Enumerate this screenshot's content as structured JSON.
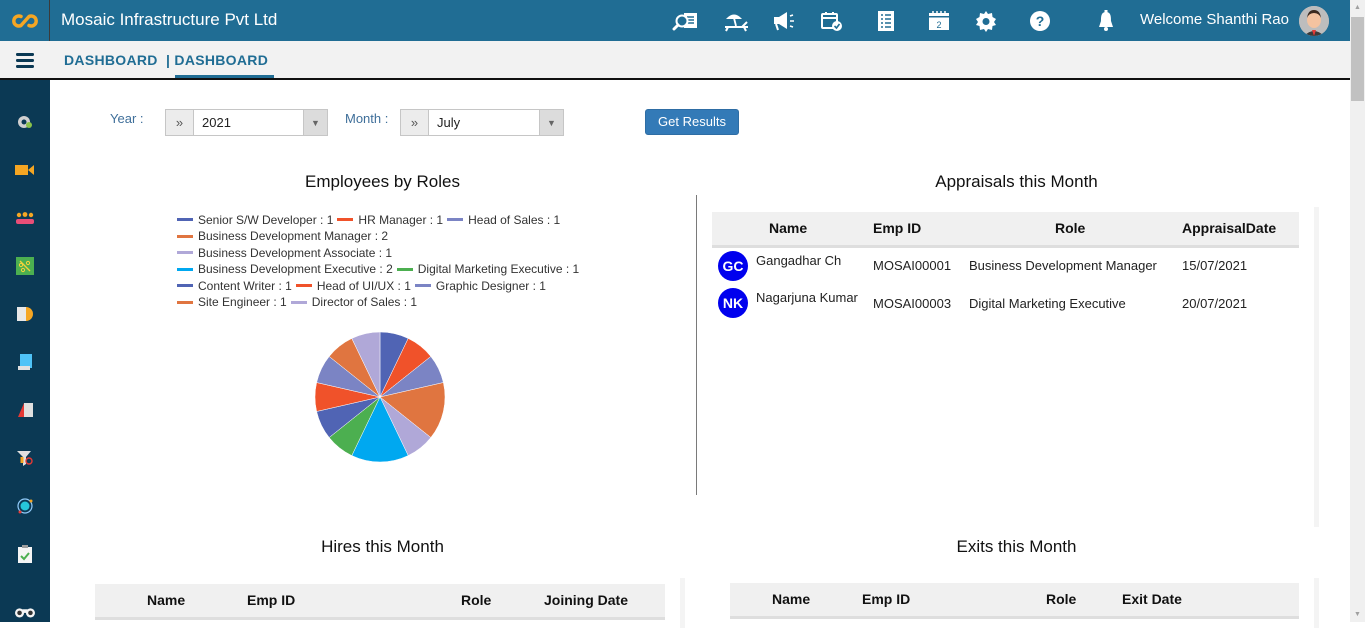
{
  "header": {
    "app_title": "Mosaic Infrastructure Pvt Ltd",
    "logo_icon": "cc-infinity-logo",
    "toolbar_icons": [
      "search-document-icon",
      "beach-holiday-icon",
      "announcement-megaphone-icon",
      "calendar-check-icon",
      "checklist-icon",
      "calendar-date-icon",
      "settings-gear-icon",
      "help-question-icon"
    ],
    "notification_icon": "bell-icon",
    "welcome_text": "Welcome Shanthi Rao",
    "accent_color": "#206d94"
  },
  "breadcrumb": {
    "items": [
      "DASHBOARD",
      "| DASHBOARD"
    ],
    "active_index": 1
  },
  "sidebar": {
    "icons": [
      "settings-user-icon",
      "video-camera-icon",
      "team-icon",
      "network-icon",
      "document-stats-icon",
      "notes-icon",
      "report-book-icon",
      "filter-search-icon",
      "orbit-icon",
      "clipboard-check-icon",
      "binoculars-icon"
    ]
  },
  "filters": {
    "year_label": "Year :",
    "year_value": "2021",
    "month_label": "Month :",
    "month_value": "July",
    "prefix_glyph": "»",
    "get_results_label": "Get Results"
  },
  "employees_by_roles": {
    "title": "Employees by Roles"
  },
  "chart_data": {
    "type": "pie",
    "title": "Employees by Roles",
    "legend_position": "top",
    "slices": [
      {
        "label": "Senior S/W Developer",
        "value": 1,
        "color": "#5064b4"
      },
      {
        "label": "HR Manager",
        "value": 1,
        "color": "#f0522a"
      },
      {
        "label": "Head of Sales",
        "value": 1,
        "color": "#7b84c4"
      },
      {
        "label": "Business Development Manager",
        "value": 2,
        "color": "#e07540"
      },
      {
        "label": "Business Development Associate",
        "value": 1,
        "color": "#b0a8d8"
      },
      {
        "label": "Business Development Executive",
        "value": 2,
        "color": "#00a8f0"
      },
      {
        "label": "Digital Marketing Executive",
        "value": 1,
        "color": "#4caf50"
      },
      {
        "label": "Content Writer",
        "value": 1,
        "color": "#5064b4"
      },
      {
        "label": "Head of UI/UX",
        "value": 1,
        "color": "#f0522a"
      },
      {
        "label": "Graphic Designer",
        "value": 1,
        "color": "#7b84c4"
      },
      {
        "label": "Site Engineer",
        "value": 1,
        "color": "#e07540"
      },
      {
        "label": "Director of Sales",
        "value": 1,
        "color": "#b0a8d8"
      }
    ],
    "legend_rows": [
      [
        0,
        1,
        2
      ],
      [
        3
      ],
      [
        4
      ],
      [
        5,
        6
      ],
      [
        7,
        8,
        9
      ],
      [
        10,
        11
      ]
    ]
  },
  "appraisals": {
    "title": "Appraisals this Month",
    "columns": [
      "Name",
      "Emp ID",
      "Role",
      "AppraisalDate"
    ],
    "rows": [
      {
        "initials": "GC",
        "name": "Gangadhar Ch",
        "emp_id": "MOSAI00001",
        "role": "Business Development Manager",
        "date": "15/07/2021"
      },
      {
        "initials": "NK",
        "name": "Nagarjuna Kumar",
        "emp_id": "MOSAI00003",
        "role": "Digital Marketing Executive",
        "date": "20/07/2021"
      }
    ]
  },
  "hires": {
    "title": "Hires this Month",
    "columns": [
      "Name",
      "Emp ID",
      "Role",
      "Joining Date"
    ]
  },
  "exits": {
    "title": "Exits this Month",
    "columns": [
      "Name",
      "Emp ID",
      "Role",
      "Exit Date"
    ]
  }
}
